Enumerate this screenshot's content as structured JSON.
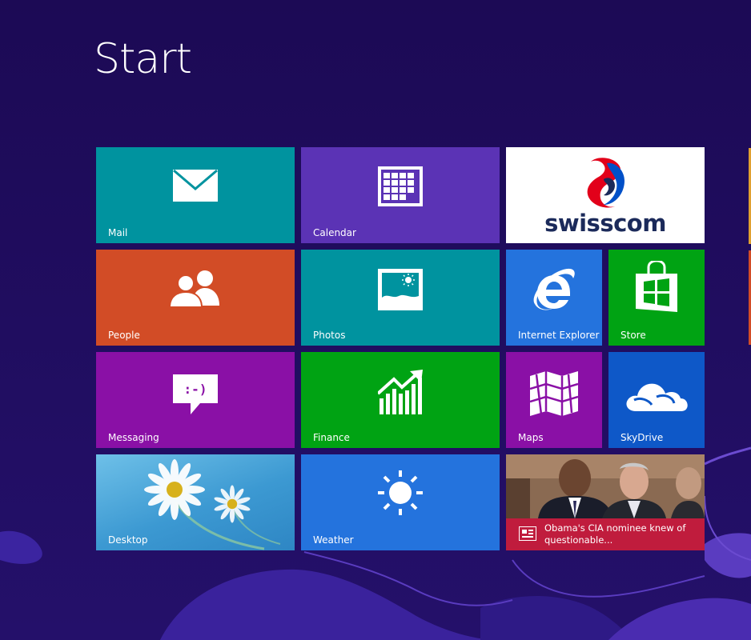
{
  "start_screen": {
    "title": "Start",
    "background_color": "#1c0a55"
  },
  "tiles": {
    "mail": {
      "label": "Mail",
      "color": "#00939f",
      "icon": "mail-icon"
    },
    "calendar": {
      "label": "Calendar",
      "color": "#5b33b5",
      "icon": "calendar-icon"
    },
    "swisscom": {
      "brand": "swisscom",
      "color": "#ffffff",
      "icon": "swisscom-logo"
    },
    "people": {
      "label": "People",
      "color": "#d24c26",
      "icon": "people-icon"
    },
    "photos": {
      "label": "Photos",
      "color": "#00939f",
      "icon": "photos-icon"
    },
    "internet_explorer": {
      "label": "Internet Explorer",
      "color": "#2473dd",
      "icon": "internet-explorer-icon"
    },
    "store": {
      "label": "Store",
      "color": "#00a313",
      "icon": "store-icon"
    },
    "messaging": {
      "label": "Messaging",
      "color": "#8a10a6",
      "icon": "messaging-icon"
    },
    "finance": {
      "label": "Finance",
      "color": "#00a313",
      "icon": "finance-icon"
    },
    "maps": {
      "label": "Maps",
      "color": "#8a10a6",
      "icon": "maps-icon"
    },
    "skydrive": {
      "label": "SkyDrive",
      "color": "#0e58c8",
      "icon": "skydrive-icon"
    },
    "desktop": {
      "label": "Desktop",
      "color": "#4aa7d8",
      "icon": "daisy-wallpaper"
    },
    "weather": {
      "label": "Weather",
      "color": "#2473dd",
      "icon": "sun-icon"
    },
    "news": {
      "headline": "Obama's CIA nominee knew of questionable...",
      "color": "#c01c3d",
      "icon": "news-icon"
    }
  }
}
